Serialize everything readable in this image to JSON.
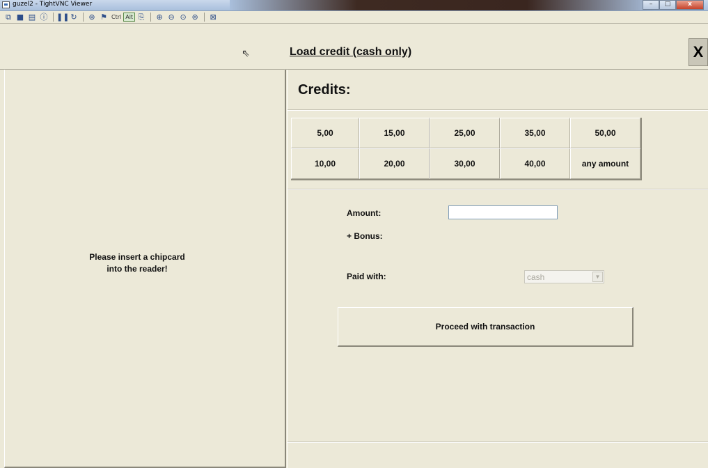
{
  "window": {
    "title": "guzel2 - TightVNC Viewer",
    "minimize": "–",
    "maximize": "□",
    "close": "x"
  },
  "toolbar": {
    "ctrl_label": "Ctrl",
    "alt_label": "Alt"
  },
  "header": {
    "title": "Load credit (cash only)",
    "close_label": "X"
  },
  "left": {
    "prompt_line1": "Please insert a chipcard",
    "prompt_line2": "into the reader!"
  },
  "credits": {
    "title": "Credits:",
    "buttons": [
      "5,00",
      "15,00",
      "25,00",
      "35,00",
      "50,00",
      "10,00",
      "20,00",
      "30,00",
      "40,00",
      "any amount"
    ]
  },
  "form": {
    "amount_label": "Amount:",
    "amount_value": "",
    "bonus_label": "+ Bonus:",
    "paid_with_label": "Paid with:",
    "paid_with_value": "cash",
    "proceed_label": "Proceed with transaction"
  }
}
